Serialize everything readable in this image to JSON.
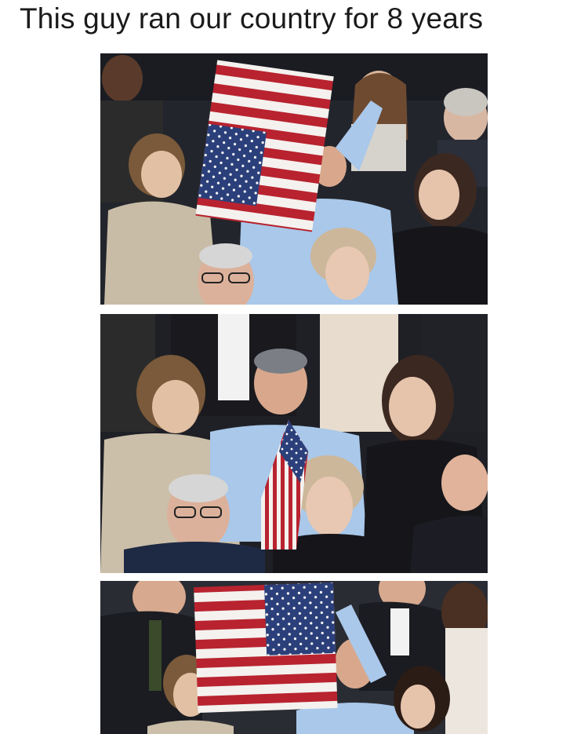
{
  "caption": "This guy ran our country for 8 years",
  "panels": [
    {
      "name": "photo-panel-1",
      "flag": "upside-down"
    },
    {
      "name": "photo-panel-2",
      "flag": "folded"
    },
    {
      "name": "photo-panel-3",
      "flag": "upright"
    }
  ],
  "colors": {
    "flag_red": "#b8232f",
    "flag_white": "#f4f1ee",
    "flag_blue": "#2b3f7a",
    "shirt_blue": "#a9c8ea",
    "crowd_dark": "#1f2026"
  },
  "icons": [
    "us-flag-icon",
    "person-silhouette-icon"
  ]
}
